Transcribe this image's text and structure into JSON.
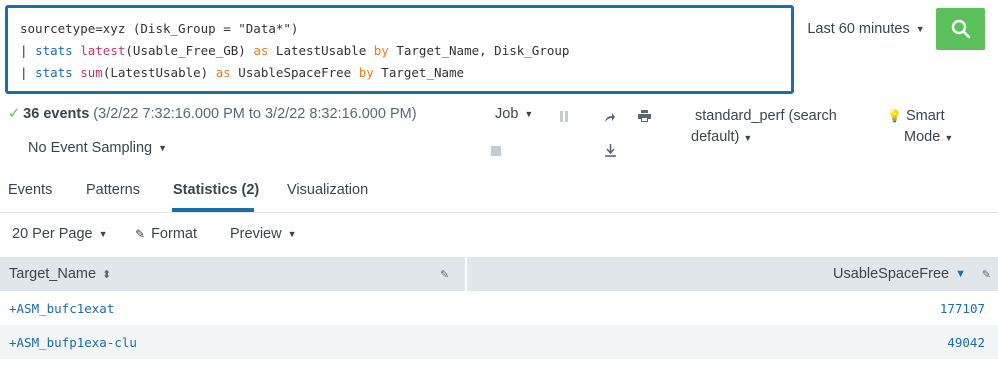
{
  "search": {
    "query_lines": [
      [
        {
          "t": "sourcetype=xyz (Disk_Group = \"Data*\")",
          "c": ""
        }
      ],
      [
        {
          "t": "| ",
          "c": ""
        },
        {
          "t": "stats",
          "c": "cmd"
        },
        {
          "t": " ",
          "c": ""
        },
        {
          "t": "latest",
          "c": "fn"
        },
        {
          "t": "(Usable_Free_GB) ",
          "c": ""
        },
        {
          "t": "as",
          "c": "op"
        },
        {
          "t": " LatestUsable ",
          "c": ""
        },
        {
          "t": "by",
          "c": "op"
        },
        {
          "t": " Target_Name, Disk_Group",
          "c": ""
        }
      ],
      [
        {
          "t": "| ",
          "c": ""
        },
        {
          "t": "stats",
          "c": "cmd"
        },
        {
          "t": " ",
          "c": ""
        },
        {
          "t": "sum",
          "c": "fn"
        },
        {
          "t": "(LatestUsable) ",
          "c": ""
        },
        {
          "t": "as",
          "c": "op"
        },
        {
          "t": " UsableSpaceFree ",
          "c": ""
        },
        {
          "t": "by",
          "c": "op"
        },
        {
          "t": " Target_Name",
          "c": ""
        }
      ]
    ],
    "time_range": "Last 60 minutes",
    "search_icon": "magnifier-icon"
  },
  "job_bar": {
    "event_count": "36 events",
    "time_span": "(3/2/22 7:32:16.000 PM to 3/2/22 8:32:16.000 PM)",
    "sampling": "No Event Sampling",
    "job_label": "Job",
    "app_context_line1": "standard_perf (search",
    "app_context_line2": "default)",
    "mode_line1": "Smart",
    "mode_line2": "Mode"
  },
  "tabs": [
    {
      "label": "Events"
    },
    {
      "label": "Patterns"
    },
    {
      "label": "Statistics (2)"
    },
    {
      "label": "Visualization"
    }
  ],
  "toolbar": {
    "per_page": "20 Per Page",
    "format": "Format",
    "preview": "Preview"
  },
  "table": {
    "columns": [
      "Target_Name",
      "UsableSpaceFree"
    ],
    "rows": [
      {
        "target": "+ASM_bufc1exat",
        "free": "177107"
      },
      {
        "target": "+ASM_bufp1exa-clu",
        "free": "49042"
      }
    ]
  },
  "colors": {
    "accent": "#1a6fa8",
    "search_button": "#5cc05c",
    "header_bg": "#e1e6eb"
  }
}
